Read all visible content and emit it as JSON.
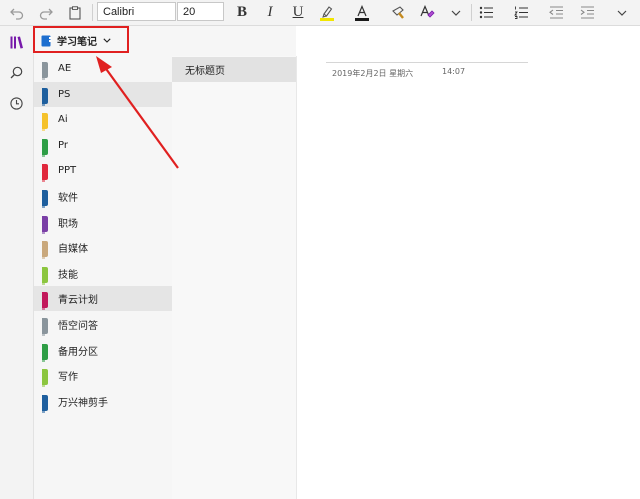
{
  "toolbar": {
    "font_name": "Calibri",
    "font_size": "20",
    "bold": "B",
    "italic": "I",
    "underline": "U",
    "highlight_color": "#f2e600",
    "font_color": "#1a1a1a"
  },
  "notebook": {
    "name": "学习笔记",
    "icon_color": "#1e6fcf"
  },
  "sections": [
    {
      "name": "AE",
      "color": "#8a959c"
    },
    {
      "name": "PS",
      "color": "#1e5f9e",
      "selected": true
    },
    {
      "name": "Ai",
      "color": "#f5c22b"
    },
    {
      "name": "Pr",
      "color": "#2e9e46"
    },
    {
      "name": "PPT",
      "color": "#e0283c"
    },
    {
      "name": "软件",
      "color": "#1e5f9e"
    },
    {
      "name": "职场",
      "color": "#7a3fa6"
    },
    {
      "name": "自媒体",
      "color": "#c9a87c"
    },
    {
      "name": "技能",
      "color": "#8cc63f"
    },
    {
      "name": "青云计划",
      "color": "#c2185b",
      "selected": true
    },
    {
      "name": "悟空问答",
      "color": "#8a959c"
    },
    {
      "name": "备用分区",
      "color": "#2e9e46"
    },
    {
      "name": "写作",
      "color": "#8cc63f"
    },
    {
      "name": "万兴神剪手",
      "color": "#1e5f9e"
    }
  ],
  "pages": [
    {
      "name": "无标题页"
    }
  ],
  "note": {
    "date": "2019年2月2日 星期六",
    "time": "14:07"
  },
  "colors": {
    "accent": "#7719aa",
    "annotation": "#e02020"
  }
}
